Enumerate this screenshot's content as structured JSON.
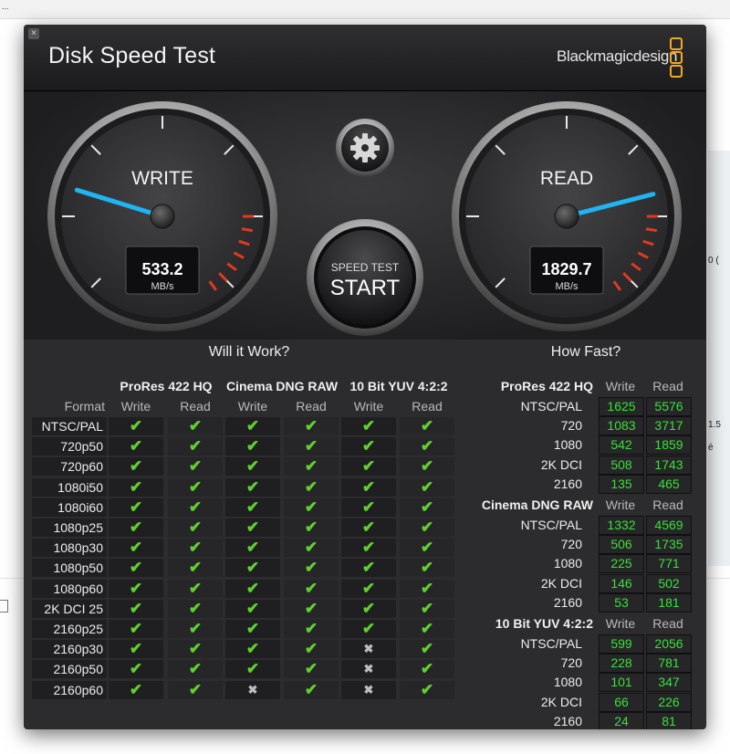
{
  "background": {
    "topbar_text": "...​",
    "right_texts": [
      "0 (",
      "1.5",
      "é"
    ]
  },
  "window": {
    "title": "Disk Speed Test",
    "brand": "Blackmagicdesign",
    "close_glyph": "×"
  },
  "gauges": {
    "write": {
      "label": "WRITE",
      "value": "533.2",
      "unit": "MB/s",
      "needle_fraction": 0.23
    },
    "read": {
      "label": "READ",
      "value": "1829.7",
      "unit": "MB/s",
      "needle_fraction": 0.78
    },
    "settings_icon": "gear-icon",
    "start": {
      "top_label": "SPEED TEST",
      "main_label": "START"
    }
  },
  "will_it_work": {
    "title": "Will it Work?",
    "format_header": "Format",
    "codecs": [
      "ProRes 422 HQ",
      "Cinema DNG RAW",
      "10 Bit YUV 4:2:2"
    ],
    "sub_headers": [
      "Write",
      "Read"
    ],
    "rows": [
      {
        "format": "NTSC/PAL",
        "marks": [
          1,
          1,
          1,
          1,
          1,
          1
        ]
      },
      {
        "format": "720p50",
        "marks": [
          1,
          1,
          1,
          1,
          1,
          1
        ]
      },
      {
        "format": "720p60",
        "marks": [
          1,
          1,
          1,
          1,
          1,
          1
        ]
      },
      {
        "format": "1080i50",
        "marks": [
          1,
          1,
          1,
          1,
          1,
          1
        ]
      },
      {
        "format": "1080i60",
        "marks": [
          1,
          1,
          1,
          1,
          1,
          1
        ]
      },
      {
        "format": "1080p25",
        "marks": [
          1,
          1,
          1,
          1,
          1,
          1
        ]
      },
      {
        "format": "1080p30",
        "marks": [
          1,
          1,
          1,
          1,
          1,
          1
        ]
      },
      {
        "format": "1080p50",
        "marks": [
          1,
          1,
          1,
          1,
          1,
          1
        ]
      },
      {
        "format": "1080p60",
        "marks": [
          1,
          1,
          1,
          1,
          1,
          1
        ]
      },
      {
        "format": "2K DCI 25",
        "marks": [
          1,
          1,
          1,
          1,
          1,
          1
        ]
      },
      {
        "format": "2160p25",
        "marks": [
          1,
          1,
          1,
          1,
          1,
          1
        ]
      },
      {
        "format": "2160p30",
        "marks": [
          1,
          1,
          1,
          1,
          0,
          1
        ]
      },
      {
        "format": "2160p50",
        "marks": [
          1,
          1,
          1,
          1,
          0,
          1
        ]
      },
      {
        "format": "2160p60",
        "marks": [
          1,
          1,
          0,
          1,
          0,
          1
        ]
      }
    ],
    "check_glyph": "✔",
    "cross_glyph": "✖"
  },
  "how_fast": {
    "title": "How Fast?",
    "sub_headers": [
      "Write",
      "Read"
    ],
    "groups": [
      {
        "name": "ProRes 422 HQ",
        "rows": [
          {
            "format": "NTSC/PAL",
            "write": "1625",
            "read": "5576"
          },
          {
            "format": "720",
            "write": "1083",
            "read": "3717"
          },
          {
            "format": "1080",
            "write": "542",
            "read": "1859"
          },
          {
            "format": "2K DCI",
            "write": "508",
            "read": "1743"
          },
          {
            "format": "2160",
            "write": "135",
            "read": "465"
          }
        ]
      },
      {
        "name": "Cinema DNG RAW",
        "rows": [
          {
            "format": "NTSC/PAL",
            "write": "1332",
            "read": "4569"
          },
          {
            "format": "720",
            "write": "506",
            "read": "1735"
          },
          {
            "format": "1080",
            "write": "225",
            "read": "771"
          },
          {
            "format": "2K DCI",
            "write": "146",
            "read": "502"
          },
          {
            "format": "2160",
            "write": "53",
            "read": "181"
          }
        ]
      },
      {
        "name": "10 Bit YUV 4:2:2",
        "rows": [
          {
            "format": "NTSC/PAL",
            "write": "599",
            "read": "2056"
          },
          {
            "format": "720",
            "write": "228",
            "read": "781"
          },
          {
            "format": "1080",
            "write": "101",
            "read": "347"
          },
          {
            "format": "2K DCI",
            "write": "66",
            "read": "226"
          },
          {
            "format": "2160",
            "write": "24",
            "read": "81"
          }
        ]
      }
    ]
  },
  "colors": {
    "needle": "#1fb4f2",
    "check": "#5fd12e",
    "number": "#38e038",
    "redline": "#e03a1e",
    "brand_logo": "#f5a623"
  }
}
